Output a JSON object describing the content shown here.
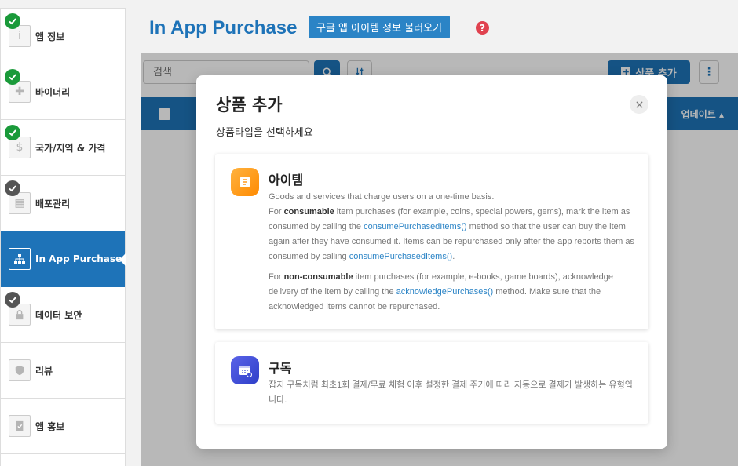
{
  "header": {
    "title": "In App Purchase",
    "import_button": "구글 앱 아이템 정보 불러오기",
    "help_glyph": "?"
  },
  "sidebar": {
    "items": [
      {
        "label": "앱 정보",
        "icon": "info-icon",
        "status": "done"
      },
      {
        "label": "바이너리",
        "icon": "puzzle-icon",
        "status": "done"
      },
      {
        "label": "국가/지역 & 가격",
        "icon": "dollar-icon",
        "status": "done"
      },
      {
        "label": "배포관리",
        "icon": "calendar-icon",
        "status": "partial"
      },
      {
        "label": "In App Purchase",
        "icon": "hierarchy-icon",
        "status": "active"
      },
      {
        "label": "데이터 보안",
        "icon": "lock-icon",
        "status": "partial"
      },
      {
        "label": "리뷰",
        "icon": "shield-icon",
        "status": "none"
      },
      {
        "label": "앱 홍보",
        "icon": "document-check-icon",
        "status": "none"
      }
    ]
  },
  "toolbar": {
    "search_placeholder": "검색",
    "add_button": "상품 추가"
  },
  "table": {
    "update_column": "업데이트"
  },
  "modal": {
    "title": "상품 추가",
    "subtitle": "상품타입을 선택하세요",
    "item_card": {
      "title": "아이템",
      "intro": "Goods and services that charge users on a one-time basis.",
      "c1": "For ",
      "c2": "consumable",
      "c3": " item purchases (for example, coins, special powers, gems), mark the item as consumed by calling the ",
      "c4": "consumePurchasedItems()",
      "c5": " method so that the user can buy the item again after they have consumed it. Items can be repurchased only after the app reports them as consumed by calling ",
      "c6": "consumePurchasedItems()",
      "c7": ".",
      "n1": "For ",
      "n2": "non-consumable",
      "n3": " item purchases (for example, e-books, game boards), acknowledge delivery of the item by calling the ",
      "n4": "acknowledgePurchases()",
      "n5": " method. Make sure that the acknowledged items cannot be repurchased."
    },
    "subscription_card": {
      "title": "구독",
      "description": "잡지 구독처럼 최초1회 결제/무료 체험 이후 설정한 결제 주기에 따라 자동으로 결제가 발생하는 유형입니다."
    }
  },
  "colors": {
    "primary": "#1e73b8",
    "done_check": "#1a9a3a",
    "partial_check": "#555555",
    "help": "#e0424f",
    "item_icon": "#ff9a1f",
    "subscription_icon": "#3f4fd6"
  }
}
